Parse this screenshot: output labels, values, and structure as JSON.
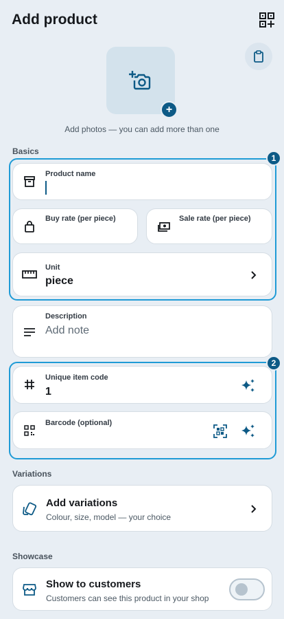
{
  "header": {
    "title": "Add product",
    "qr_icon": "qr-add-icon"
  },
  "photo": {
    "hint": "Add photos — you can add more than one",
    "add_symbol": "+"
  },
  "sections": {
    "basics": "Basics",
    "variations": "Variations",
    "showcase": "Showcase"
  },
  "badges": {
    "one": "1",
    "two": "2"
  },
  "fields": {
    "product_name": {
      "label": "Product name",
      "value": ""
    },
    "buy_rate": {
      "label": "Buy rate (per piece)"
    },
    "sale_rate": {
      "label": "Sale rate (per piece)"
    },
    "unit": {
      "label": "Unit",
      "value": "piece"
    },
    "description": {
      "label": "Description",
      "placeholder": "Add note"
    },
    "item_code": {
      "label": "Unique item code",
      "value": "1"
    },
    "barcode": {
      "label": "Barcode (optional)"
    }
  },
  "variations": {
    "title": "Add variations",
    "subtitle": "Colour, size, model — your choice"
  },
  "showcase": {
    "title": "Show to customers",
    "subtitle": "Customers can see this product in your shop",
    "enabled": false
  },
  "colors": {
    "accent": "#0d5a86",
    "highlight": "#1f9bd6",
    "background": "#e8eef4"
  }
}
